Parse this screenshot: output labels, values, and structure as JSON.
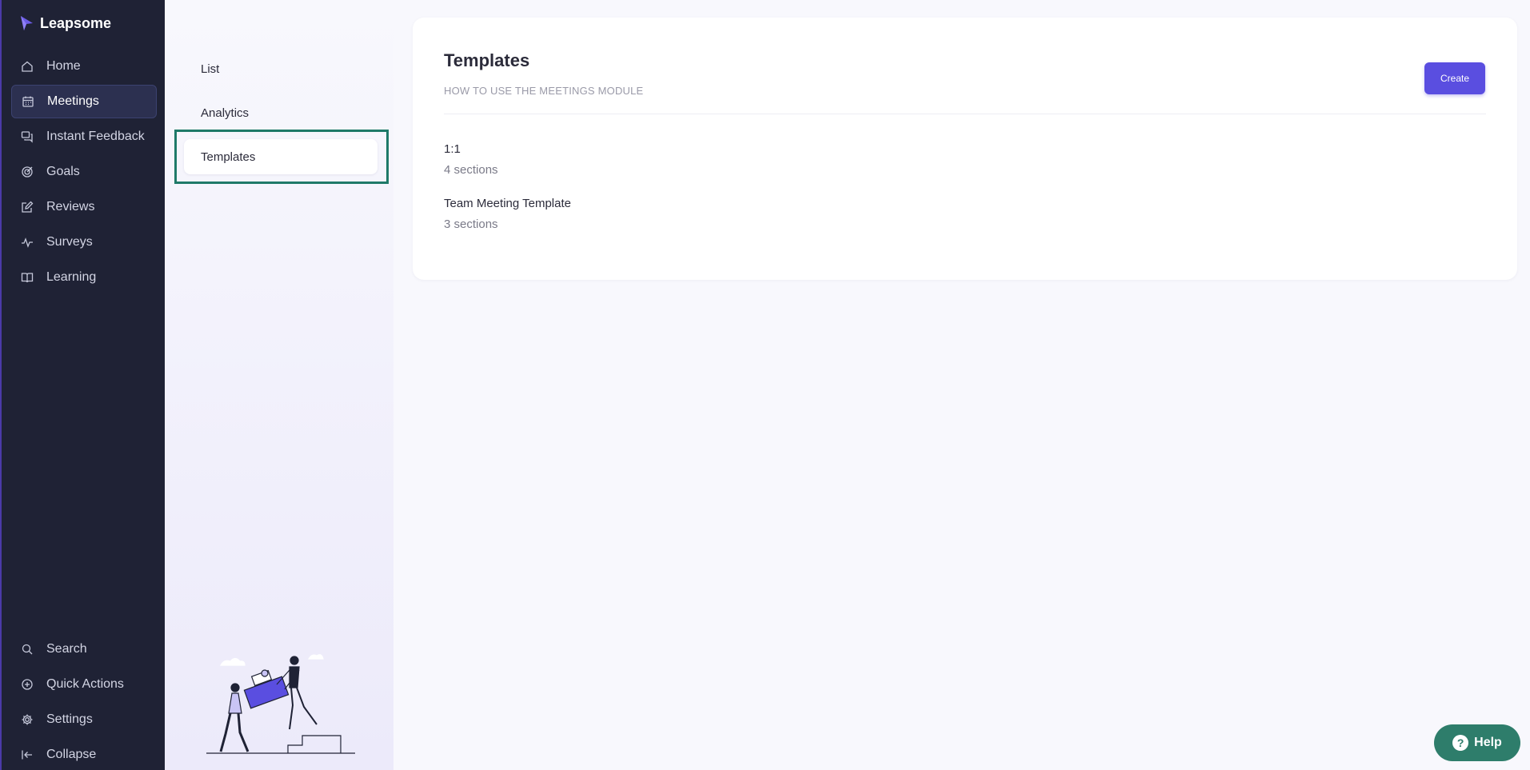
{
  "app": {
    "brand": "Leapsome"
  },
  "sidebar": {
    "items": [
      {
        "label": "Home",
        "icon": "home-icon"
      },
      {
        "label": "Meetings",
        "icon": "calendar-icon",
        "active": true
      },
      {
        "label": "Instant Feedback",
        "icon": "chat-icon"
      },
      {
        "label": "Goals",
        "icon": "target-icon"
      },
      {
        "label": "Reviews",
        "icon": "edit-icon"
      },
      {
        "label": "Surveys",
        "icon": "pulse-icon"
      },
      {
        "label": "Learning",
        "icon": "book-icon"
      }
    ],
    "bottom_items": [
      {
        "label": "Search",
        "icon": "search-icon"
      },
      {
        "label": "Quick Actions",
        "icon": "plus-circle-icon"
      },
      {
        "label": "Settings",
        "icon": "gear-icon"
      },
      {
        "label": "Collapse",
        "icon": "collapse-icon"
      }
    ]
  },
  "subnav": {
    "items": [
      {
        "label": "List"
      },
      {
        "label": "Analytics"
      },
      {
        "label": "Templates",
        "active": true
      }
    ]
  },
  "main": {
    "title": "Templates",
    "help_link": "HOW TO USE THE MEETINGS MODULE",
    "create_label": "Create",
    "templates": [
      {
        "name": "1:1",
        "sections": "4 sections"
      },
      {
        "name": "Team Meeting Template",
        "sections": "3 sections"
      }
    ]
  },
  "help": {
    "label": "Help",
    "icon_glyph": "?"
  },
  "colors": {
    "sidebar_bg": "#1f2235",
    "accent": "#5a4ee0",
    "help_green": "#2e7d6b",
    "focus_ring": "#1f7a68"
  }
}
